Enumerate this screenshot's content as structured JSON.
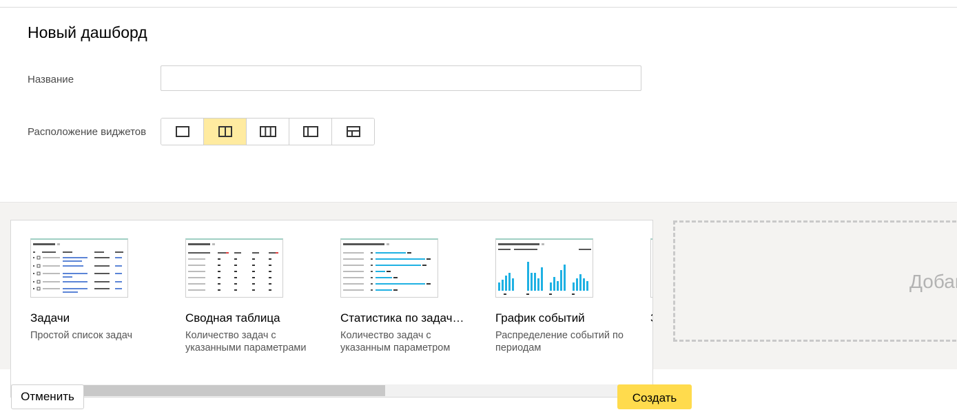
{
  "page": {
    "title": "Новый дашборд"
  },
  "form": {
    "name_label": "Название",
    "name_value": "",
    "name_placeholder": "",
    "layout_label": "Расположение виджетов",
    "layout_options": [
      "one-column-icon",
      "two-columns-icon",
      "three-columns-icon",
      "sidebar-left-icon",
      "header-two-columns-icon"
    ],
    "layout_selected_index": 1
  },
  "widgets": [
    {
      "title": "Задачи",
      "description": "Простой список задач"
    },
    {
      "title": "Сводная таблица",
      "description": "Количество задач с указанными параметрами"
    },
    {
      "title": "Статистика по задачам",
      "description": "Количество задач с указанным параметром"
    },
    {
      "title": "График событий",
      "description": "Распределение событий по периодам"
    },
    {
      "title": "З",
      "description": ""
    }
  ],
  "add_widget": {
    "label": "Добавить виджет"
  },
  "footer": {
    "cancel_label": "Отменить",
    "create_label": "Создать"
  },
  "colors": {
    "accent_yellow": "#ffdb4d",
    "selected_bg": "#ffeba0",
    "chart_blue": "#1fb1e3",
    "list_blue": "#5b84d6"
  }
}
